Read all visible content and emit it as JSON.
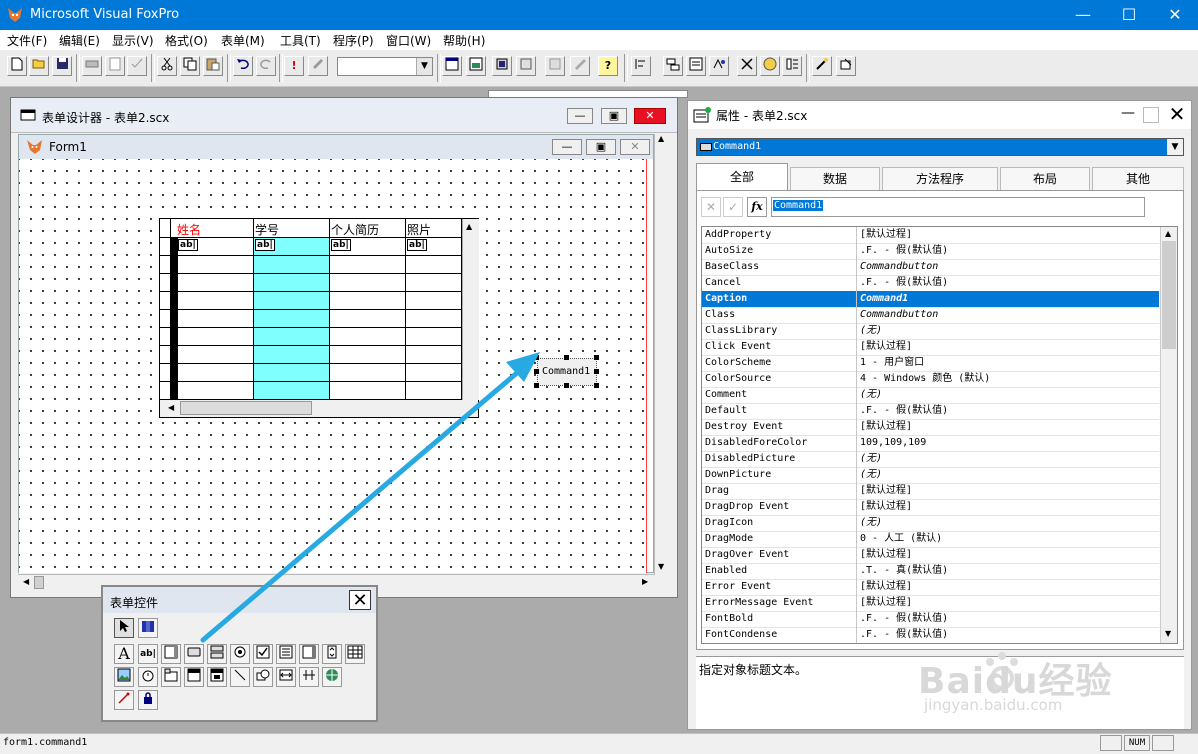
{
  "app": {
    "title": "Microsoft Visual FoxPro"
  },
  "menu": [
    "文件(F)",
    "编辑(E)",
    "显示(V)",
    "格式(O)",
    "表单(M)",
    "工具(T)",
    "程序(P)",
    "窗口(W)",
    "帮助(H)"
  ],
  "toolbar": {
    "exclaim": "!",
    "help": "?"
  },
  "designer": {
    "title": "表单设计器 - 表单2.scx",
    "form_title": "Form1",
    "grid": {
      "headers": [
        "姓名",
        "学号",
        "个人简历",
        "照片"
      ],
      "textbox_glyph": "ab|",
      "highlight_color": "#80ffff",
      "first_header_color": "#ff0000"
    },
    "command_button": {
      "caption": "Command1"
    }
  },
  "props": {
    "title": "属性 - 表单2.scx",
    "object": "Command1",
    "tabs": [
      "全部",
      "数据",
      "方法程序",
      "布局",
      "其他"
    ],
    "edit_value": "Command1",
    "fx_label": "fx",
    "rows": [
      {
        "name": "AddProperty",
        "value": "[默认过程]"
      },
      {
        "name": "AutoSize",
        "value": ".F. - 假(默认值)"
      },
      {
        "name": "BaseClass",
        "value": "Commandbutton"
      },
      {
        "name": "Cancel",
        "value": ".F. - 假(默认值)"
      },
      {
        "name": "Caption",
        "value": "Command1",
        "selected": true
      },
      {
        "name": "Class",
        "value": "Commandbutton"
      },
      {
        "name": "ClassLibrary",
        "value": "(无)"
      },
      {
        "name": "Click Event",
        "value": "[默认过程]"
      },
      {
        "name": "ColorScheme",
        "value": "1 - 用户窗口"
      },
      {
        "name": "ColorSource",
        "value": "4 - Windows 颜色 (默认)"
      },
      {
        "name": "Comment",
        "value": "(无)"
      },
      {
        "name": "Default",
        "value": ".F. - 假(默认值)"
      },
      {
        "name": "Destroy Event",
        "value": "[默认过程]"
      },
      {
        "name": "DisabledForeColor",
        "value": "109,109,109"
      },
      {
        "name": "DisabledPicture",
        "value": "(无)"
      },
      {
        "name": "DownPicture",
        "value": "(无)"
      },
      {
        "name": "Drag",
        "value": "[默认过程]"
      },
      {
        "name": "DragDrop Event",
        "value": "[默认过程]"
      },
      {
        "name": "DragIcon",
        "value": "(无)"
      },
      {
        "name": "DragMode",
        "value": "0 - 人工 (默认)"
      },
      {
        "name": "DragOver Event",
        "value": "[默认过程]"
      },
      {
        "name": "Enabled",
        "value": ".T. - 真(默认值)"
      },
      {
        "name": "Error Event",
        "value": "[默认过程]"
      },
      {
        "name": "ErrorMessage Event",
        "value": "[默认过程]"
      },
      {
        "name": "FontBold",
        "value": ".F. - 假(默认值)"
      },
      {
        "name": "FontCondense",
        "value": ".F. - 假(默认值)"
      }
    ],
    "description": "指定对象标题文本。"
  },
  "controls": {
    "title": "表单控件",
    "label_glyph": "A",
    "text_glyph": "ab|"
  },
  "watermark": {
    "brand": "Baidu经验",
    "url": "jingyan.baidu.com"
  },
  "status": {
    "left": "form1.command1",
    "num": "NUM"
  },
  "colors": {
    "accent": "#0078d7",
    "arrow": "#29a9e1",
    "selection": "#0078d7"
  }
}
